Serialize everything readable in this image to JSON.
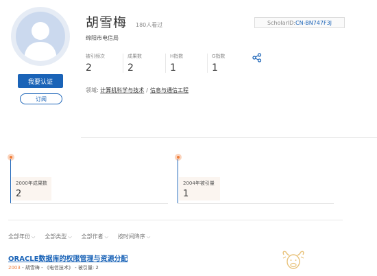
{
  "profile": {
    "name": "胡雪梅",
    "views": "180人看过",
    "institution": "绵阳市电信局",
    "scholar_label": "ScholarID:",
    "scholar_id": "CN-BN747F3J"
  },
  "buttons": {
    "claim": "我要认证",
    "subscribe": "订阅"
  },
  "stats": [
    {
      "label": "被引频次",
      "value": "2"
    },
    {
      "label": "成果数",
      "value": "2"
    },
    {
      "label": "H指数",
      "value": "1"
    },
    {
      "label": "G指数",
      "value": "1"
    }
  ],
  "field": {
    "label": "领域:",
    "items": [
      "计算机科学与技术",
      "信息与通信工程"
    ],
    "separator": "/"
  },
  "timeline": [
    {
      "label": "2000年成果数",
      "value": "2"
    },
    {
      "label": "2004年被引量",
      "value": "1"
    }
  ],
  "filters": [
    {
      "label": "全部年份"
    },
    {
      "label": "全部类型"
    },
    {
      "label": "全部作者"
    },
    {
      "label": "按时间降序"
    }
  ],
  "paper": {
    "title": "ORACLE数据库的权限管理与资源分配",
    "year": "2003",
    "author": "胡雪梅",
    "journal": "《电信技术》",
    "citations": "被引量: 2"
  },
  "colors": {
    "accent": "#1a63b7",
    "orange": "#ef7d3a"
  },
  "icons": {
    "avatar": "user-silhouette-icon",
    "share": "share-icon",
    "chevron": "chevron-down-icon",
    "logo": "ox-logo"
  }
}
